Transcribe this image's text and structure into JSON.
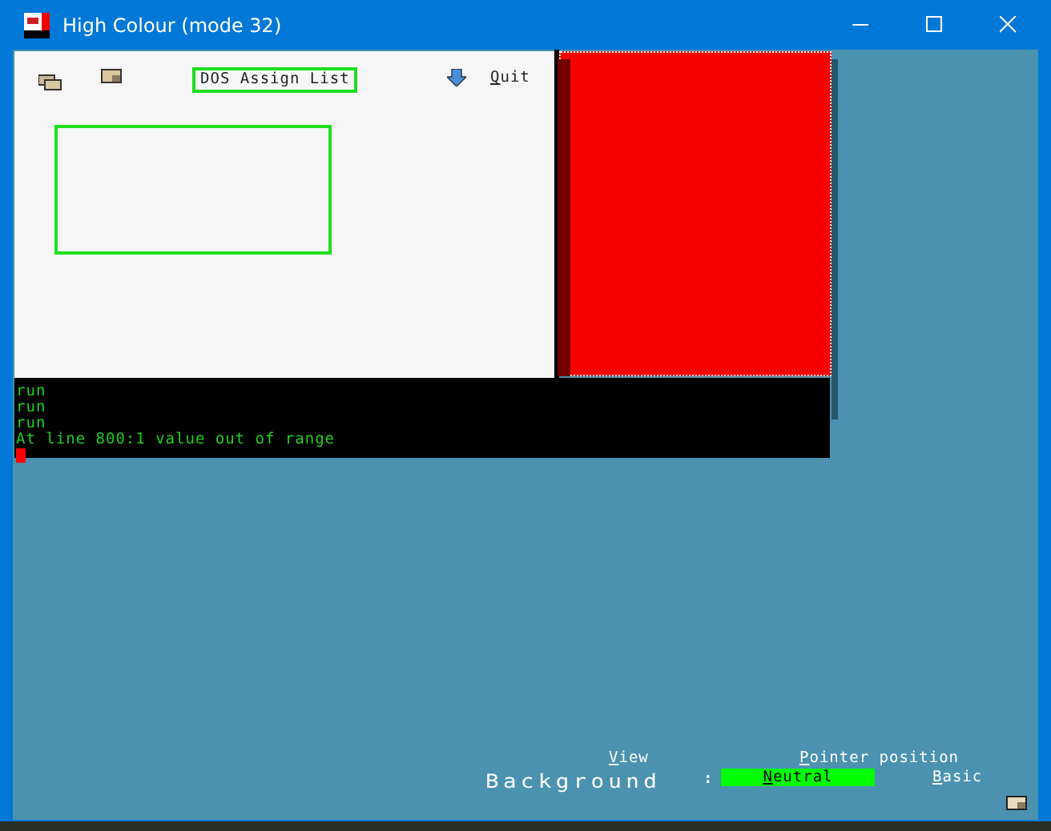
{
  "window": {
    "title": "High Colour (mode 32)"
  },
  "toolbar": {
    "title": "DOS Assign List",
    "quit": "Quit"
  },
  "console": {
    "lines": [
      "run",
      "run",
      "run",
      "At line 800:1 value out of range"
    ]
  },
  "status": {
    "view": "View",
    "pointer": "Pointer position",
    "label": "Background",
    "separator": ":",
    "value": "Neutral",
    "mode": "Basic"
  }
}
